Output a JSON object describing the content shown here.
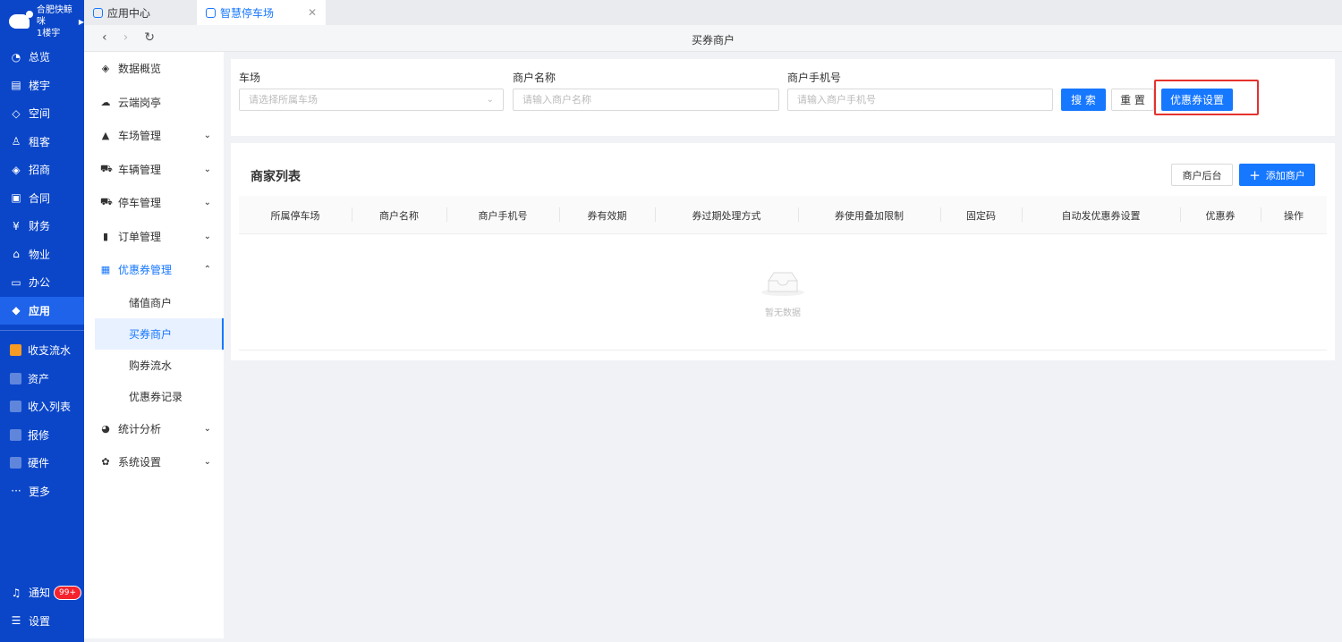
{
  "rail": {
    "org_name": "合肥快鲸咪",
    "building": "1楼宇",
    "items": [
      {
        "label": "总览",
        "icon": "gauge-icon"
      },
      {
        "label": "楼宇",
        "icon": "building-icon"
      },
      {
        "label": "空间",
        "icon": "cube-icon"
      },
      {
        "label": "租客",
        "icon": "users-icon"
      },
      {
        "label": "招商",
        "icon": "tag-icon"
      },
      {
        "label": "合同",
        "icon": "document-icon"
      },
      {
        "label": "财务",
        "icon": "yen-icon"
      },
      {
        "label": "物业",
        "icon": "home-icon"
      },
      {
        "label": "办公",
        "icon": "monitor-icon"
      },
      {
        "label": "应用",
        "icon": "app-cube-icon"
      }
    ],
    "apps": [
      {
        "label": "收支流水"
      },
      {
        "label": "资产"
      },
      {
        "label": "收入列表"
      },
      {
        "label": "报修"
      },
      {
        "label": "硬件"
      },
      {
        "label": "更多"
      }
    ],
    "notify_label": "通知",
    "notify_badge": "99+",
    "settings_label": "设置"
  },
  "tabs": [
    {
      "label": "应用中心"
    },
    {
      "label": "智慧停车场"
    }
  ],
  "nav": {
    "title": "买券商户"
  },
  "side": {
    "items": [
      {
        "label": "数据概览"
      },
      {
        "label": "云端岗亭"
      },
      {
        "label": "车场管理"
      },
      {
        "label": "车辆管理"
      },
      {
        "label": "停车管理"
      },
      {
        "label": "订单管理"
      },
      {
        "label": "优惠券管理"
      }
    ],
    "subs": [
      {
        "label": "储值商户"
      },
      {
        "label": "买券商户"
      },
      {
        "label": "购券流水"
      },
      {
        "label": "优惠券记录"
      }
    ],
    "after": [
      {
        "label": "统计分析"
      },
      {
        "label": "系统设置"
      }
    ]
  },
  "filter": {
    "lot_label": "车场",
    "lot_placeholder": "请选择所属车场",
    "name_label": "商户名称",
    "name_placeholder": "请输入商户名称",
    "phone_label": "商户手机号",
    "phone_placeholder": "请输入商户手机号",
    "search_btn": "搜 索",
    "reset_btn": "重 置",
    "coupon_btn": "优惠券设置"
  },
  "list": {
    "title": "商家列表",
    "backend_btn": "商户后台",
    "add_btn": "添加商户",
    "columns": [
      "所属停车场",
      "商户名称",
      "商户手机号",
      "券有效期",
      "券过期处理方式",
      "券使用叠加限制",
      "固定码",
      "自动发优惠券设置",
      "优惠券",
      "操作"
    ],
    "empty_text": "暂无数据"
  },
  "colors": {
    "primary": "#1677ff",
    "rail": "#0b46c9",
    "highlight": "#e5322d"
  }
}
